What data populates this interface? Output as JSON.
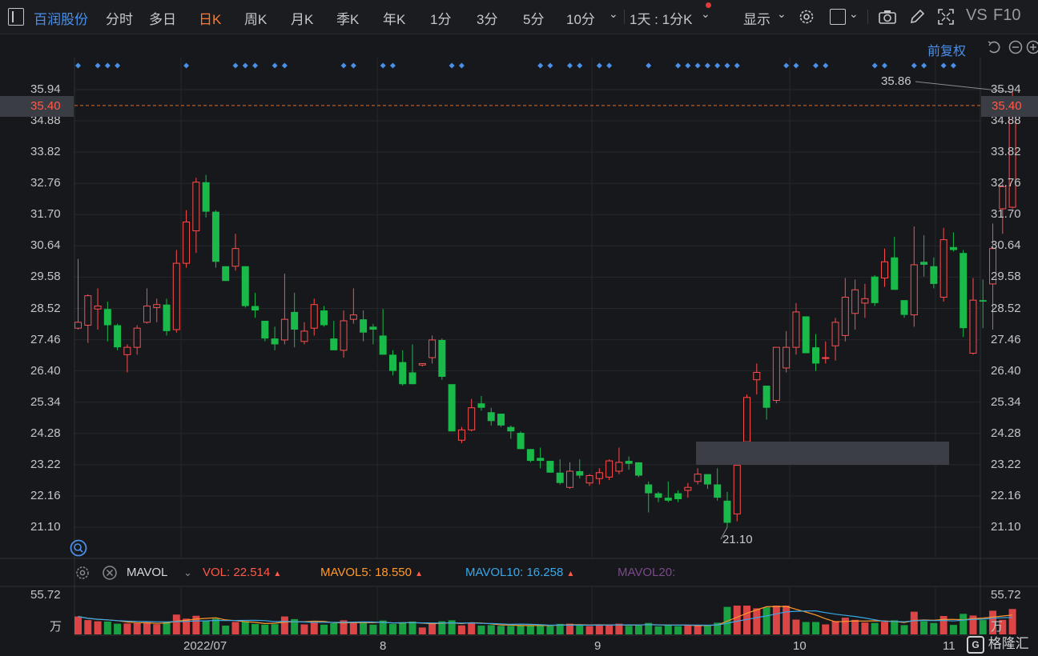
{
  "toolbar": {
    "stock_name": "百润股份",
    "tabs": [
      "分时",
      "多日",
      "日K",
      "周K",
      "月K",
      "季K",
      "年K",
      "1分",
      "3分",
      "5分",
      "10分"
    ],
    "active_tab": "日K",
    "period_select": "1天 : 1分K",
    "display_label": "显示",
    "vs_label": "VS",
    "f10_label": "F10"
  },
  "adjust_label": "前复权",
  "price_axis": {
    "ticks": [
      "35.94",
      "34.88",
      "33.82",
      "32.76",
      "31.70",
      "30.64",
      "29.58",
      "28.52",
      "27.46",
      "26.40",
      "25.34",
      "24.28",
      "23.22",
      "22.16",
      "21.10"
    ],
    "current_price": "35.40",
    "ylim": [
      20.5,
      36.6
    ]
  },
  "annotations": {
    "high": "35.86",
    "low": "21.10"
  },
  "volume_legend": {
    "indicator": "MAVOL",
    "vol_label": "VOL:",
    "vol_value": "22.514",
    "mavol5_label": "MAVOL5:",
    "mavol5_value": "18.550",
    "mavol10_label": "MAVOL10:",
    "mavol10_value": "16.258",
    "mavol20_label": "MAVOL20:"
  },
  "volume_axis": {
    "max": "55.72",
    "unit": "万"
  },
  "x_axis": {
    "labels": [
      "2022/07",
      "8",
      "9",
      "10",
      "11"
    ]
  },
  "colors": {
    "up": "#ff4d4d",
    "down": "#19b94a",
    "accent": "#ff7a2f",
    "link": "#4a8fe8",
    "ref_line": "#e06a2a"
  },
  "brand": "格隆汇",
  "chart_data": {
    "type": "candlestick",
    "series": [
      {
        "o": 27.85,
        "h": 30.2,
        "l": 27.8,
        "c": 28.05
      },
      {
        "o": 27.95,
        "h": 29.0,
        "l": 27.35,
        "c": 28.95
      },
      {
        "o": 28.5,
        "h": 29.2,
        "l": 27.8,
        "c": 28.6
      },
      {
        "o": 28.5,
        "h": 28.75,
        "l": 27.4,
        "c": 27.95
      },
      {
        "o": 27.95,
        "h": 28.0,
        "l": 27.1,
        "c": 27.2
      },
      {
        "o": 26.95,
        "h": 27.3,
        "l": 26.35,
        "c": 27.2
      },
      {
        "o": 27.2,
        "h": 27.95,
        "l": 26.95,
        "c": 27.85
      },
      {
        "o": 28.05,
        "h": 29.2,
        "l": 28.0,
        "c": 28.6
      },
      {
        "o": 28.55,
        "h": 28.85,
        "l": 28.05,
        "c": 28.65
      },
      {
        "o": 28.65,
        "h": 28.85,
        "l": 27.6,
        "c": 27.75
      },
      {
        "o": 27.8,
        "h": 30.5,
        "l": 27.7,
        "c": 30.05
      },
      {
        "o": 30.05,
        "h": 31.85,
        "l": 29.9,
        "c": 31.45
      },
      {
        "o": 31.15,
        "h": 32.95,
        "l": 30.4,
        "c": 32.8
      },
      {
        "o": 32.8,
        "h": 33.05,
        "l": 31.6,
        "c": 31.8
      },
      {
        "o": 31.8,
        "h": 31.85,
        "l": 29.9,
        "c": 30.1
      },
      {
        "o": 29.95,
        "h": 29.95,
        "l": 29.45,
        "c": 29.45
      },
      {
        "o": 29.95,
        "h": 31.05,
        "l": 29.8,
        "c": 30.55
      },
      {
        "o": 29.95,
        "h": 29.95,
        "l": 28.55,
        "c": 28.6
      },
      {
        "o": 28.6,
        "h": 29.05,
        "l": 28.2,
        "c": 28.45
      },
      {
        "o": 28.1,
        "h": 28.1,
        "l": 27.4,
        "c": 27.5
      },
      {
        "o": 27.5,
        "h": 27.9,
        "l": 27.1,
        "c": 27.3
      },
      {
        "o": 27.45,
        "h": 29.7,
        "l": 27.3,
        "c": 28.15
      },
      {
        "o": 28.4,
        "h": 29.05,
        "l": 27.2,
        "c": 27.8
      },
      {
        "o": 27.4,
        "h": 28.05,
        "l": 27.3,
        "c": 27.75
      },
      {
        "o": 27.85,
        "h": 28.85,
        "l": 27.6,
        "c": 28.65
      },
      {
        "o": 28.45,
        "h": 28.6,
        "l": 27.9,
        "c": 27.95
      },
      {
        "o": 27.5,
        "h": 28.1,
        "l": 27.1,
        "c": 27.1
      },
      {
        "o": 27.1,
        "h": 28.45,
        "l": 26.85,
        "c": 28.1
      },
      {
        "o": 28.15,
        "h": 29.2,
        "l": 28.0,
        "c": 28.3
      },
      {
        "o": 28.15,
        "h": 28.45,
        "l": 27.4,
        "c": 27.7
      },
      {
        "o": 27.9,
        "h": 28.0,
        "l": 27.3,
        "c": 27.8
      },
      {
        "o": 27.6,
        "h": 28.5,
        "l": 26.95,
        "c": 26.95
      },
      {
        "o": 26.95,
        "h": 27.1,
        "l": 26.25,
        "c": 26.4
      },
      {
        "o": 26.7,
        "h": 27.1,
        "l": 25.9,
        "c": 25.95
      },
      {
        "o": 26.35,
        "h": 27.3,
        "l": 25.95,
        "c": 25.95
      },
      {
        "o": 26.6,
        "h": 26.65,
        "l": 26.55,
        "c": 26.65
      },
      {
        "o": 26.85,
        "h": 27.6,
        "l": 26.65,
        "c": 27.45
      },
      {
        "o": 27.45,
        "h": 27.5,
        "l": 26.1,
        "c": 26.2
      },
      {
        "o": 25.95,
        "h": 25.95,
        "l": 24.35,
        "c": 24.35
      },
      {
        "o": 24.05,
        "h": 24.5,
        "l": 23.95,
        "c": 24.4
      },
      {
        "o": 24.4,
        "h": 25.45,
        "l": 24.35,
        "c": 25.15
      },
      {
        "o": 25.3,
        "h": 25.55,
        "l": 25.05,
        "c": 25.15
      },
      {
        "o": 25.0,
        "h": 25.15,
        "l": 24.55,
        "c": 24.7
      },
      {
        "o": 24.95,
        "h": 24.95,
        "l": 24.5,
        "c": 24.55
      },
      {
        "o": 24.5,
        "h": 24.55,
        "l": 24.1,
        "c": 24.35
      },
      {
        "o": 24.3,
        "h": 24.35,
        "l": 23.75,
        "c": 23.75
      },
      {
        "o": 23.75,
        "h": 23.75,
        "l": 23.3,
        "c": 23.35
      },
      {
        "o": 23.45,
        "h": 23.8,
        "l": 23.1,
        "c": 23.35
      },
      {
        "o": 23.35,
        "h": 23.35,
        "l": 22.95,
        "c": 22.95
      },
      {
        "o": 22.95,
        "h": 23.4,
        "l": 22.55,
        "c": 22.6
      },
      {
        "o": 22.45,
        "h": 23.3,
        "l": 22.4,
        "c": 23.0
      },
      {
        "o": 23.0,
        "h": 23.4,
        "l": 22.75,
        "c": 22.85
      },
      {
        "o": 22.6,
        "h": 22.9,
        "l": 22.5,
        "c": 22.85
      },
      {
        "o": 22.75,
        "h": 23.1,
        "l": 22.55,
        "c": 22.95
      },
      {
        "o": 22.8,
        "h": 23.4,
        "l": 22.7,
        "c": 23.35
      },
      {
        "o": 23.0,
        "h": 23.8,
        "l": 22.9,
        "c": 23.3
      },
      {
        "o": 23.35,
        "h": 23.5,
        "l": 23.05,
        "c": 23.25
      },
      {
        "o": 23.3,
        "h": 23.3,
        "l": 22.8,
        "c": 22.85
      },
      {
        "o": 22.55,
        "h": 22.65,
        "l": 21.6,
        "c": 22.25
      },
      {
        "o": 22.25,
        "h": 22.3,
        "l": 21.95,
        "c": 22.1
      },
      {
        "o": 22.1,
        "h": 22.65,
        "l": 21.95,
        "c": 22.0
      },
      {
        "o": 22.25,
        "h": 22.35,
        "l": 21.95,
        "c": 22.05
      },
      {
        "o": 22.35,
        "h": 22.6,
        "l": 22.1,
        "c": 22.45
      },
      {
        "o": 22.65,
        "h": 23.1,
        "l": 22.55,
        "c": 22.9
      },
      {
        "o": 22.9,
        "h": 22.9,
        "l": 22.4,
        "c": 22.55
      },
      {
        "o": 22.55,
        "h": 23.1,
        "l": 22.0,
        "c": 22.1
      },
      {
        "o": 22.0,
        "h": 22.3,
        "l": 21.1,
        "c": 21.25
      },
      {
        "o": 21.55,
        "h": 23.3,
        "l": 21.3,
        "c": 23.2
      },
      {
        "o": 24.0,
        "h": 25.6,
        "l": 23.9,
        "c": 25.5
      },
      {
        "o": 26.1,
        "h": 26.65,
        "l": 25.6,
        "c": 26.35
      },
      {
        "o": 25.9,
        "h": 25.9,
        "l": 24.75,
        "c": 25.15
      },
      {
        "o": 25.4,
        "h": 26.75,
        "l": 25.3,
        "c": 27.2
      },
      {
        "o": 26.5,
        "h": 27.75,
        "l": 26.35,
        "c": 27.2
      },
      {
        "o": 27.2,
        "h": 28.7,
        "l": 26.95,
        "c": 28.4
      },
      {
        "o": 28.25,
        "h": 28.25,
        "l": 27.0,
        "c": 27.0
      },
      {
        "o": 27.2,
        "h": 27.65,
        "l": 26.4,
        "c": 26.65
      },
      {
        "o": 26.85,
        "h": 27.4,
        "l": 26.65,
        "c": 26.85
      },
      {
        "o": 27.25,
        "h": 28.2,
        "l": 26.75,
        "c": 28.05
      },
      {
        "o": 27.6,
        "h": 29.55,
        "l": 27.4,
        "c": 28.9
      },
      {
        "o": 28.35,
        "h": 29.5,
        "l": 27.8,
        "c": 29.15
      },
      {
        "o": 28.7,
        "h": 29.35,
        "l": 28.2,
        "c": 28.85
      },
      {
        "o": 29.6,
        "h": 29.65,
        "l": 28.6,
        "c": 28.7
      },
      {
        "o": 29.55,
        "h": 30.55,
        "l": 29.25,
        "c": 30.1
      },
      {
        "o": 30.25,
        "h": 30.95,
        "l": 29.35,
        "c": 29.15
      },
      {
        "o": 28.8,
        "h": 28.8,
        "l": 28.2,
        "c": 28.3
      },
      {
        "o": 28.3,
        "h": 31.3,
        "l": 27.9,
        "c": 30.0
      },
      {
        "o": 30.1,
        "h": 31.0,
        "l": 29.6,
        "c": 30.0
      },
      {
        "o": 29.95,
        "h": 30.25,
        "l": 29.2,
        "c": 29.35
      },
      {
        "o": 28.9,
        "h": 31.25,
        "l": 28.75,
        "c": 30.85
      },
      {
        "o": 30.6,
        "h": 31.1,
        "l": 30.45,
        "c": 30.5
      },
      {
        "o": 30.4,
        "h": 30.5,
        "l": 27.55,
        "c": 27.85
      },
      {
        "o": 27.0,
        "h": 29.55,
        "l": 26.95,
        "c": 28.8
      },
      {
        "o": 28.8,
        "h": 29.5,
        "l": 27.85,
        "c": 28.75
      },
      {
        "o": 29.35,
        "h": 31.4,
        "l": 27.8,
        "c": 30.55
      },
      {
        "o": 31.9,
        "h": 32.75,
        "l": 31.05,
        "c": 32.65
      },
      {
        "o": 31.95,
        "h": 35.86,
        "l": 31.9,
        "c": 35.4
      }
    ]
  }
}
